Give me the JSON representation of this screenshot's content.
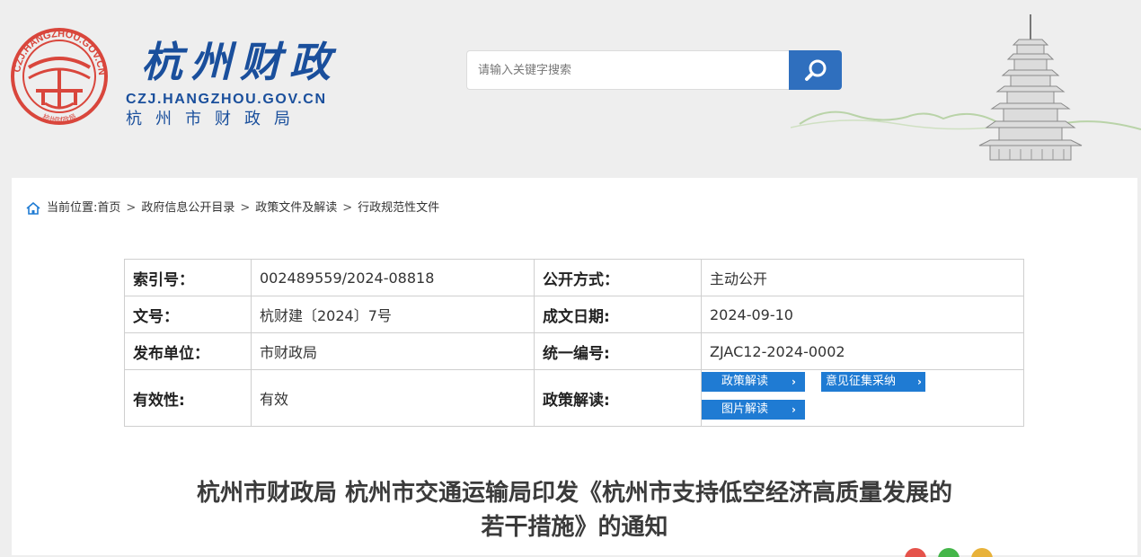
{
  "header": {
    "logo_cn": "杭州财政",
    "logo_domain": "CZJ.HANGZHOU.GOV.CN",
    "logo_org": "杭州市财政局",
    "emblem_text": "CZJ.HANGZHOU.GOV.CN",
    "emblem_bottom": "杭州财政局",
    "search": {
      "placeholder": "请输入关键字搜索",
      "value": ""
    }
  },
  "breadcrumb": {
    "prefix": "当前位置:",
    "items": [
      "首页",
      "政府信息公开目录",
      "政策文件及解读",
      "行政规范性文件"
    ],
    "separator": ">"
  },
  "meta": {
    "rows": [
      {
        "l1": "索引号：",
        "v1": "002489559/2024-08818",
        "l2": "公开方式：",
        "v2": "主动公开"
      },
      {
        "l1": "文号：",
        "v1": "杭财建〔2024〕7号",
        "l2": "成文日期:",
        "v2": "2024-09-10"
      },
      {
        "l1": "发布单位：",
        "v1": "市财政局",
        "l2": "统一编号:",
        "v2": "ZJAC12-2024-0002"
      },
      {
        "l1": "有效性:",
        "v1": "有效",
        "l2": "政策解读:"
      }
    ],
    "buttons": [
      "政策解读",
      "意见征集采纳",
      "图片解读"
    ],
    "chevron": "›"
  },
  "document": {
    "title_line1": "杭州市财政局 杭州市交通运输局印发《杭州市支持低空经济高质量发展的",
    "title_line2": "若干措施》的通知"
  },
  "colors": {
    "brand_blue": "#1a4f9c",
    "emblem_red": "#d9463c",
    "button_blue": "#1f7bd3",
    "search_blue": "#2f6fbe"
  }
}
